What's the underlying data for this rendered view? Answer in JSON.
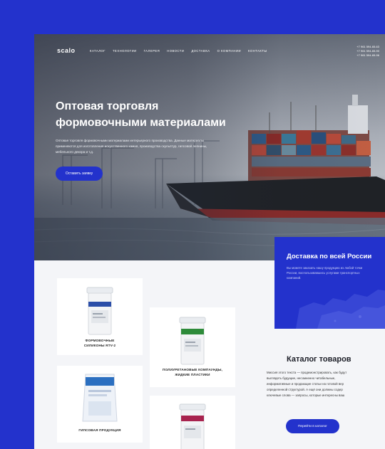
{
  "header": {
    "logo": "scalo",
    "nav": [
      "КАТАЛОГ",
      "ТЕХНОЛОГИИ",
      "ГАЛЕРЕЯ",
      "НОВОСТИ",
      "ДОСТАВКА",
      "О КОМПАНИИ",
      "КОНТАКТЫ"
    ],
    "phones": [
      "+7 961 594-65-63",
      "+7 961 594-65-90",
      "+7 961 594-65-96"
    ]
  },
  "hero": {
    "title_line1": "Оптовая торговля",
    "title_line2": "формовочными материалами",
    "text": "Оптовая торговля формовочными материалами интерьерного производства. Данные материалы применяются для изготовления искусственного камня, производства скульптур, гипсовой лепнины, мебельного декора и т.д.",
    "cta_label": "Оставить заявку"
  },
  "delivery": {
    "title": "Доставка по всей России",
    "text": "Вы можете заказать нашу продукцию из любой точки России, воспользовавшись услугами транспортных компаний."
  },
  "products": [
    {
      "line1": "ФОРМОВОЧНЫЕ",
      "line2": "СИЛИКОНЫ RTV-2",
      "accent": "#2b4ea8"
    },
    {
      "line1": "ПОЛИУРЕТАНОВЫЕ КОМПАУНДЫ,",
      "line2": "ЖИДКИЕ ПЛАСТИКИ",
      "accent": "#2e8b3a"
    },
    {
      "line1": "ГИПСОВАЯ ПРОДУКЦИЯ",
      "line2": "",
      "accent": "#2b6fc0"
    },
    {
      "line1": "",
      "line2": "",
      "accent": "#a8234e"
    }
  ],
  "catalog": {
    "title": "Каталог товаров",
    "lines": [
      "Миссия этого текста — продемонстрировать, как будут",
      "выглядеть будущие, несомненно читабельные,",
      "информативные и продающие статьи на готовой вер",
      "определенной структурой. А ещё они должны содер",
      "ключевые слова — запросы, которые интересны ваш"
    ],
    "button_label": "Перейти в каталог"
  },
  "colors": {
    "brand": "#2332cc",
    "page_bg": "#f4f5f8"
  }
}
